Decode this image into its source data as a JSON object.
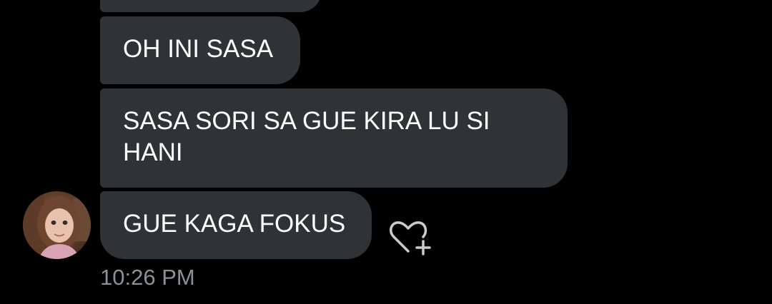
{
  "conversation": {
    "messages": [
      {
        "text": ""
      },
      {
        "text": "OH INI SASA"
      },
      {
        "text": "SASA SORI SA GUE KIRA LU SI HANI"
      },
      {
        "text": "GUE KAGA FOKUS"
      }
    ],
    "last_message_time": "10:26 PM"
  },
  "icons": {
    "avatar": "user-avatar",
    "react": "heart-plus-icon"
  },
  "colors": {
    "background": "#000000",
    "bubble": "#2f3336",
    "text": "#ffffff",
    "timestamp": "#8b9096",
    "icon": "#c8ccd0"
  }
}
